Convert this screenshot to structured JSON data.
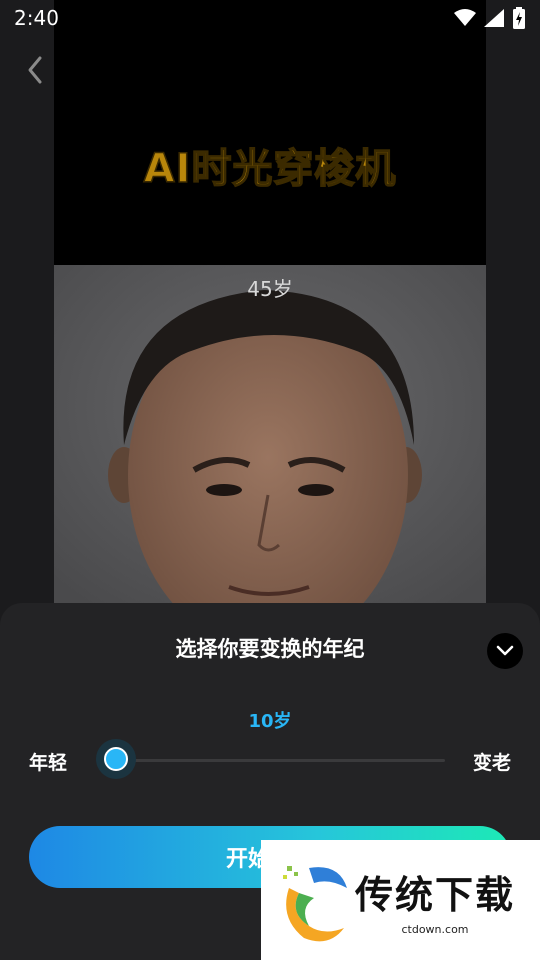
{
  "statusbar": {
    "time": "2:40",
    "icons": [
      "wifi-icon",
      "signal-icon",
      "battery-charging-icon"
    ]
  },
  "nav": {
    "back_icon": "chevron-left-icon"
  },
  "preview": {
    "banner_title": "AI时光穿梭机",
    "age_label": "45岁"
  },
  "sheet": {
    "title": "选择你要变换的年纪",
    "collapse_icon": "chevron-down-icon",
    "age_value": "10岁",
    "slider_min_label": "年轻",
    "slider_max_label": "变老",
    "slider_value_fraction": 0.0,
    "start_button_label": "开始变换"
  },
  "watermark": {
    "brand": "传统下载",
    "url": "ctdown.com"
  },
  "colors": {
    "accent": "#29b6f6",
    "button_start": "#1e88e5",
    "button_end": "#1de9b6",
    "sheet_bg": "#232325"
  }
}
